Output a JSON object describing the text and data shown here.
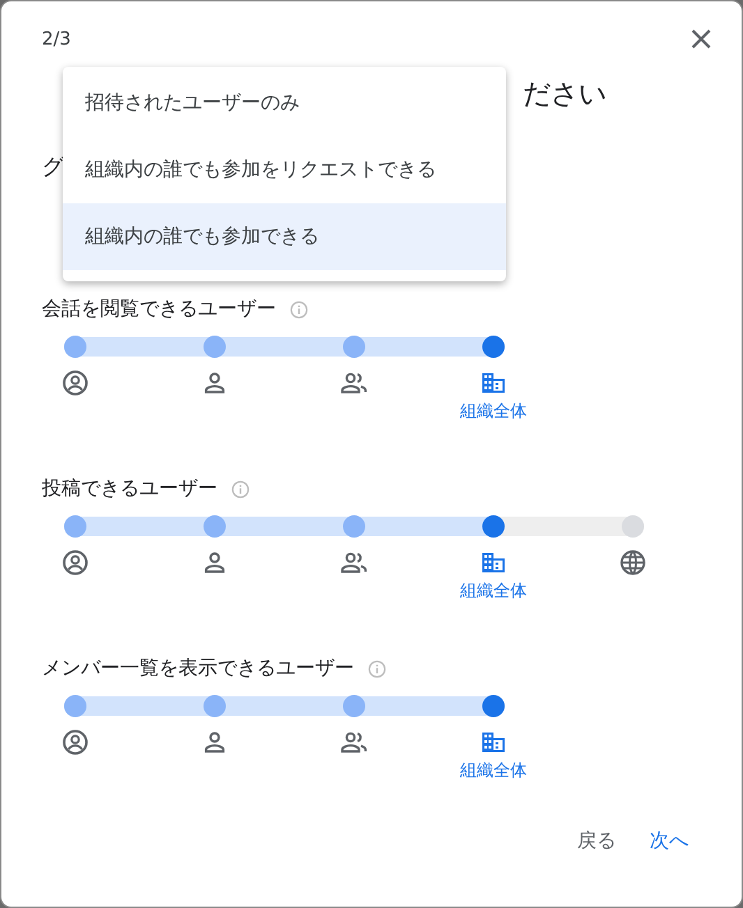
{
  "dialog": {
    "step": "2/3",
    "heading": "ださい",
    "field_label": "グ"
  },
  "menu": {
    "items": [
      {
        "label": "招待されたユーザーのみ",
        "selected": false
      },
      {
        "label": "組織内の誰でも参加をリクエストできる",
        "selected": false
      },
      {
        "label": "組織内の誰でも参加できる",
        "selected": true
      }
    ]
  },
  "sliders": [
    {
      "label": "会話を閲覧できるユーザー",
      "stops": [
        {
          "kind": "account",
          "selected": false
        },
        {
          "kind": "person",
          "selected": false
        },
        {
          "kind": "people",
          "selected": false
        },
        {
          "kind": "organization",
          "selected": true,
          "label": "組織全体"
        }
      ]
    },
    {
      "label": "投稿できるユーザー",
      "stops": [
        {
          "kind": "account",
          "selected": false
        },
        {
          "kind": "person",
          "selected": false
        },
        {
          "kind": "people",
          "selected": false
        },
        {
          "kind": "organization",
          "selected": true,
          "label": "組織全体"
        },
        {
          "kind": "globe",
          "selected": false
        }
      ]
    },
    {
      "label": "メンバー一覧を表示できるユーザー",
      "stops": [
        {
          "kind": "account",
          "selected": false
        },
        {
          "kind": "person",
          "selected": false
        },
        {
          "kind": "people",
          "selected": false
        },
        {
          "kind": "organization",
          "selected": true,
          "label": "組織全体"
        }
      ]
    }
  ],
  "buttons": [
    {
      "label": "戻る",
      "kind": "secondary"
    },
    {
      "label": "次へ",
      "kind": "primary"
    }
  ]
}
